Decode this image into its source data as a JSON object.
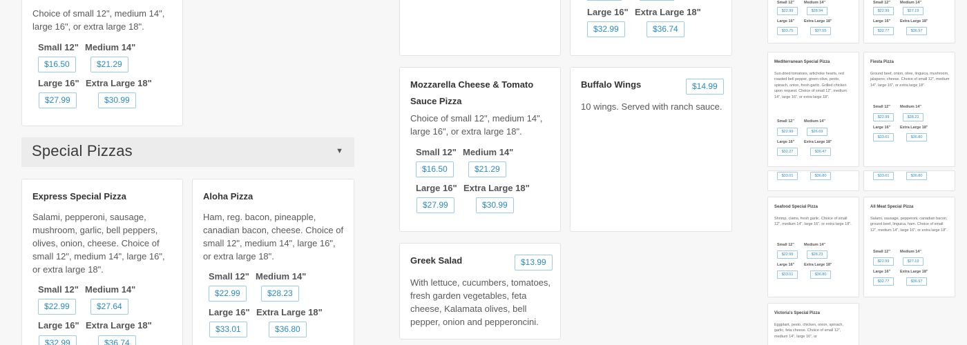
{
  "pizza_desc": "Choice of small 12\", medium 14\", large 16\", or extra large 18\".",
  "sizes": {
    "small": "Small 12\"",
    "medium": "Medium 14\"",
    "large": "Large 16\"",
    "xlarge": "Extra Large 18\""
  },
  "top_left_card": {
    "prices": [
      "$16.50",
      "$21.29",
      "$27.99",
      "$30.99"
    ]
  },
  "section": {
    "title": "Special Pizzas",
    "chevron": "▼"
  },
  "express": {
    "title": "Express Special Pizza",
    "desc": "Salami, pepperoni, sausage, mushroom, garlic, bell peppers, olives, onion, cheese. Choice of small 12\", medium 14\", large 16\", or extra large 18\".",
    "prices": [
      "$22.99",
      "$27.64",
      "$32.99",
      "$36.74"
    ]
  },
  "aloha": {
    "title": "Aloha Pizza",
    "desc": "Ham, reg. bacon, pineapple, canadian bacon, cheese. Choice of small 12\", medium 14\", large 16\", or extra large 18\".",
    "prices": [
      "$22.99",
      "$28.23",
      "$33.01",
      "$36.80"
    ]
  },
  "top_mid_card": {
    "prices": [
      "$32.99",
      "$36.74"
    ]
  },
  "mozzarella": {
    "title": "Mozzarella Cheese & Tomato Sauce Pizza",
    "desc": "Choice of small 12\", medium 14\", large 16\", or extra large 18\".",
    "prices": [
      "$16.50",
      "$21.29",
      "$27.99",
      "$30.99"
    ]
  },
  "buffalo": {
    "title": "Buffalo Wings",
    "price": "$14.99",
    "desc": "10 wings. Served with ranch sauce."
  },
  "greek": {
    "title": "Greek Salad",
    "price": "$13.99",
    "desc": "With lettuce, cucumbers, tomatoes, fresh garden vegetables, feta cheese, Kalamata olives, bell pepper, onion and pepperoncini."
  },
  "mini": {
    "top_a": {
      "prices": [
        "$22.99",
        "$28.94",
        "$33.75",
        "$37.55"
      ]
    },
    "top_b": {
      "prices": [
        "$22.99",
        "$27.19",
        "$32.77",
        "$36.97"
      ]
    },
    "mediterranean": {
      "title": "Mediterranean Special Pizza",
      "desc": "Sun dried tomatoes, artichoke hearts, red roasted bell pepper, green olive, pesto, spinach, onion, fresh garlic. Grilled chicken upon request. Choice of small 12\", medium 14\", large 16\", or extra large 18\".",
      "prices": [
        "$22.99",
        "$26.69",
        "$32.27",
        "$36.47"
      ]
    },
    "fiesta": {
      "title": "Fiesta Pizza",
      "desc": "Ground beef, onion, olive, linguica, mushroom, jalapeno, cheese. Choice of small 12\", medium 14\", large 16\", or extra large 18\".",
      "prices": [
        "$22.99",
        "$28.23",
        "$33.01",
        "$36.80"
      ]
    },
    "strip_a": {
      "prices": [
        "$33.01",
        "$36.80"
      ]
    },
    "strip_b": {
      "prices": [
        "$33.01",
        "$36.80"
      ]
    },
    "seafood": {
      "title": "Seafood Special Pizza",
      "desc": "Shrimp, clams, fresh garlic. Choice of small 12\", medium 14\", large 16\", or extra large 18\".",
      "prices": [
        "$22.99",
        "$28.23",
        "$33.01",
        "$36.80"
      ]
    },
    "allmeat": {
      "title": "All Meat Special Pizza",
      "desc": "Salami, sausage, pepperoni, canadian bacon, ground beef, linguica, ham. Choice of small 12\", medium 14\", large 16\", or extra large 18\".",
      "prices": [
        "$22.99",
        "$27.19",
        "$32.77",
        "$36.97"
      ]
    },
    "victoria": {
      "title": "Victoria's Special Pizza",
      "desc": "Eggplant, pesto, chicken, onion, spinach, garlic, feta cheese. Choice of small 12\", medium 14\", large 16\", or"
    }
  }
}
